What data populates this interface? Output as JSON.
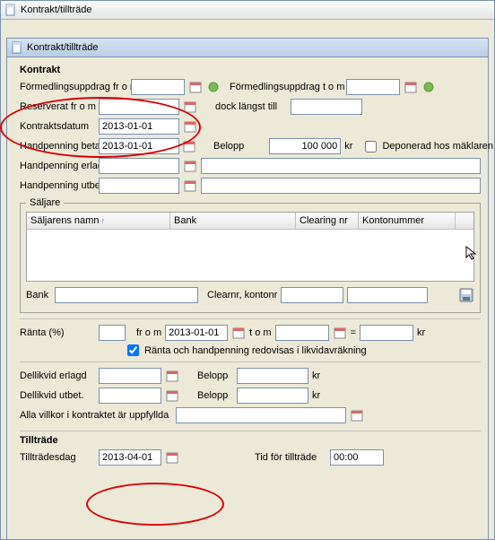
{
  "outer": {
    "title": "Kontrakt/tillträde"
  },
  "inner": {
    "title": "Kontrakt/tillträde"
  },
  "icons": {
    "doc": "doc-icon",
    "cal": "calendar-icon",
    "action": "action-icon",
    "save": "save-icon",
    "cursor": "cursor-icon"
  },
  "kontrakt": {
    "title": "Kontrakt",
    "formedling_from_label": "Förmedlingsuppdrag fr o m",
    "formedling_from_value": "",
    "formedling_to_label": "Förmedlingsuppdrag t o m",
    "formedling_to_value": "",
    "reserverat_label": "Reserverat fr o m",
    "reserverat_value": "",
    "dock_label": "dock längst till",
    "dock_value": "",
    "kontraktsdatum_label": "Kontraktsdatum",
    "kontraktsdatum_value": "2013-01-01",
    "handpenning_betalas_label": "Handpenning betalas",
    "handpenning_betalas_value": "2013-01-01",
    "belopp_label": "Belopp",
    "belopp_value": "100 000",
    "belopp_unit": "kr",
    "deponerad_label": "Deponerad hos mäklaren",
    "deponerad_checked": false,
    "handpenning_erlagd_label": "Handpenning erlagd",
    "handpenning_erlagd_value": "",
    "handpenning_erlagd_note": "",
    "handpenning_utbetald_label": "Handpenning utbetald",
    "handpenning_utbetald_value": "",
    "handpenning_utbetald_note": ""
  },
  "saljare": {
    "legend": "Säljare",
    "cols": {
      "namn": "Säljarens namn",
      "bank": "Bank",
      "clearing": "Clearing nr",
      "konto": "Kontonummer"
    },
    "bank_label": "Bank",
    "bank_value": "",
    "clearnr_label": "Clearnr, kontonr",
    "clearnr_value": "",
    "konto_value": ""
  },
  "ranta": {
    "label": "Ränta (%)",
    "pct_value": "",
    "from_label": "fr o m",
    "from_value": "2013-01-01",
    "tom_label": "t o m",
    "tom_value": "",
    "equals": "=",
    "result_value": "",
    "result_unit": "kr",
    "redovisas_label": "Ränta och handpenning redovisas i likvidavräkning",
    "redovisas_checked": true
  },
  "dellikvid": {
    "erlagd_label": "Dellikvid erlagd",
    "erlagd_value": "",
    "utbet_label": "Dellikvid utbet.",
    "utbet_value": "",
    "belopp_label": "Belopp",
    "belopp1_value": "",
    "belopp2_value": "",
    "unit": "kr"
  },
  "villkor": {
    "label": "Alla villkor i kontraktet är uppfyllda",
    "value": ""
  },
  "tilltrade": {
    "title": "Tillträde",
    "dag_label": "Tillträdesdag",
    "dag_value": "2013-04-01",
    "tid_label": "Tid för tillträde",
    "tid_value": "00:00"
  }
}
